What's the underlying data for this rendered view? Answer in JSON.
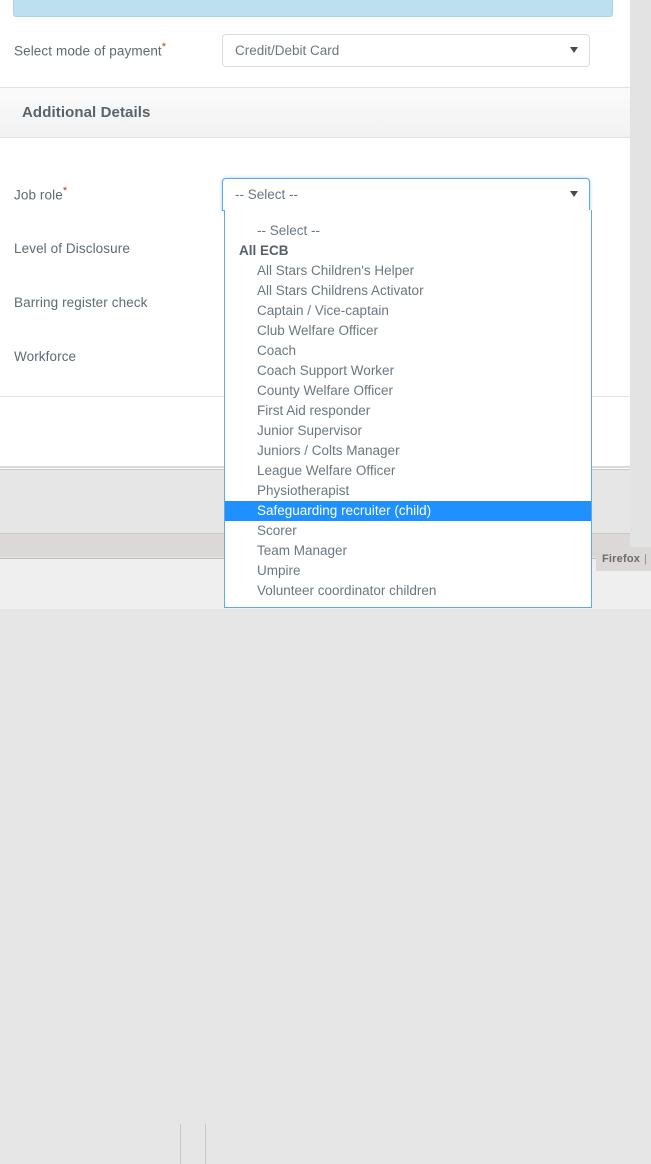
{
  "alert": {
    "text": ""
  },
  "form": {
    "payment": {
      "label": "Select mode of payment",
      "required_marker": "*",
      "value": "Credit/Debit Card"
    }
  },
  "section": {
    "title": "Additional Details"
  },
  "additional_details": {
    "job_role": {
      "label": "Job role",
      "required_marker": "*",
      "value": "-- Select --"
    },
    "level_of_disclosure": {
      "label": "Level of Disclosure"
    },
    "barring_register_check": {
      "label": "Barring register check"
    },
    "workforce": {
      "label": "Workforce"
    }
  },
  "dropdown": {
    "selected_value": "Safeguarding recruiter (child)",
    "items": [
      {
        "type": "option",
        "label": "-- Select --"
      },
      {
        "type": "group",
        "label": "All ECB"
      },
      {
        "type": "option",
        "label": "All Stars Children's Helper"
      },
      {
        "type": "option",
        "label": "All Stars Childrens Activator"
      },
      {
        "type": "option",
        "label": "Captain / Vice-captain"
      },
      {
        "type": "option",
        "label": "Club Welfare Officer"
      },
      {
        "type": "option",
        "label": "Coach"
      },
      {
        "type": "option",
        "label": "Coach Support Worker"
      },
      {
        "type": "option",
        "label": "County Welfare Officer"
      },
      {
        "type": "option",
        "label": "First Aid responder"
      },
      {
        "type": "option",
        "label": "Junior Supervisor"
      },
      {
        "type": "option",
        "label": "Juniors / Colts Manager"
      },
      {
        "type": "option",
        "label": "League Welfare Officer"
      },
      {
        "type": "option",
        "label": "Physiotherapist"
      },
      {
        "type": "option",
        "label": "Safeguarding recruiter (child)"
      },
      {
        "type": "option",
        "label": "Scorer"
      },
      {
        "type": "option",
        "label": "Team Manager"
      },
      {
        "type": "option",
        "label": "Umpire"
      },
      {
        "type": "option",
        "label": "Volunteer coordinator children"
      }
    ]
  },
  "taskbar": {
    "firefox_label": "Firefox",
    "firefox_separator": "|"
  },
  "colors": {
    "highlight": "#1e90ff",
    "focus_border": "#5ea9e8",
    "alert_bg": "#bde0f0",
    "label_text": "#5d6b76"
  }
}
